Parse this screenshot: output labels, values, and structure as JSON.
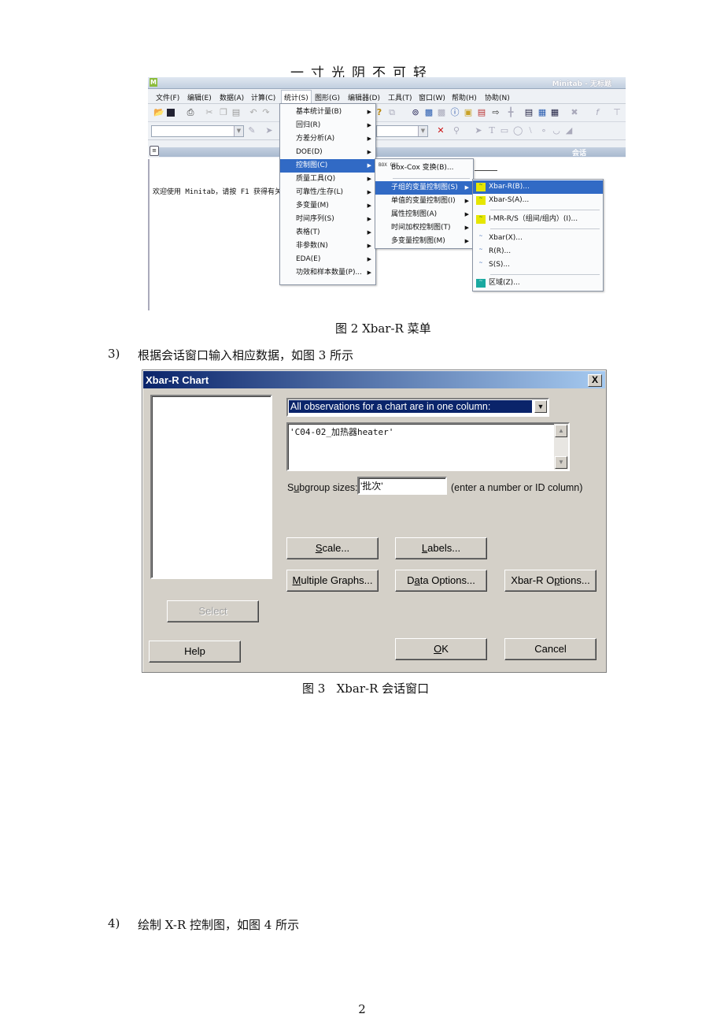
{
  "page_header": "一寸光阴不可轻",
  "minitab": {
    "title": "Minitab - 无标题",
    "menubar": [
      "文件(F)",
      "编辑(E)",
      "数据(A)",
      "计算(C)",
      "统计(S)",
      "图形(G)",
      "编辑器(D)",
      "工具(T)",
      "窗口(W)",
      "帮助(H)",
      "协助(N)"
    ],
    "session_label": "会话",
    "welcome_text": "欢迎使用 Minitab，请按 F1 获得有关",
    "stat_menu": [
      "基本统计量(B)",
      "回归(R)",
      "方差分析(A)",
      "DOE(D)",
      "控制图(C)",
      "质量工具(Q)",
      "可靠性/生存(L)",
      "多变量(M)",
      "时间序列(S)",
      "表格(T)",
      "非参数(N)",
      "EDA(E)",
      "功效和样本数量(P)..."
    ],
    "stat_menu_selected": "控制图(C)",
    "control_chart_menu": {
      "boxcox_icon": "BOX COX",
      "boxcox": "Box-Cox 变换(B)...",
      "items": [
        "子组的变量控制图(S)",
        "单值的变量控制图(I)",
        "属性控制图(A)",
        "时间加权控制图(T)",
        "多变量控制图(M)"
      ],
      "selected": "子组的变量控制图(S)"
    },
    "subgroup_menu": {
      "items": [
        {
          "label": "Xbar-R(B)...",
          "icon": "xbar-r-chart-icon"
        },
        {
          "label": "Xbar-S(A)...",
          "icon": "xbar-s-chart-icon"
        },
        {
          "label": "I-MR-R/S（组间/组内）(I)...",
          "icon": "imrr-chart-icon"
        },
        {
          "label": "Xbar(X)...",
          "icon": "xbar-chart-icon"
        },
        {
          "label": "R(R)...",
          "icon": "r-chart-icon"
        },
        {
          "label": "S(S)...",
          "icon": "s-chart-icon"
        },
        {
          "label": "区域(Z)...",
          "icon": "zone-chart-icon"
        }
      ],
      "selected": "Xbar-R(B)..."
    }
  },
  "figure2_caption": "图 2 Xbar-R 菜单",
  "step3": {
    "number": "3)",
    "text": "根据会话窗口输入相应数据，如图 3 所示"
  },
  "dialog": {
    "title": "Xbar-R Chart",
    "close_label": "X",
    "chart_type_selected": "All observations for a chart are in one column:",
    "columns_value": "'C04-02_加热器heater'",
    "subgroup_label": "Subgroup sizes:",
    "subgroup_value": "'批次'",
    "subgroup_hint": "(enter a number or ID column)",
    "buttons": {
      "scale": "Scale...",
      "labels": "Labels...",
      "multiple_graphs": "Multiple Graphs...",
      "data_options": "Data Options...",
      "xbar_r_options": "Xbar-R Options...",
      "select": "Select",
      "help": "Help",
      "ok": "OK",
      "cancel": "Cancel"
    }
  },
  "figure3_caption": "图 3   Xbar-R 会话窗口",
  "step4": {
    "number": "4)",
    "text": "绘制 X-R 控制图，如图 4 所示"
  },
  "page_number": "2"
}
